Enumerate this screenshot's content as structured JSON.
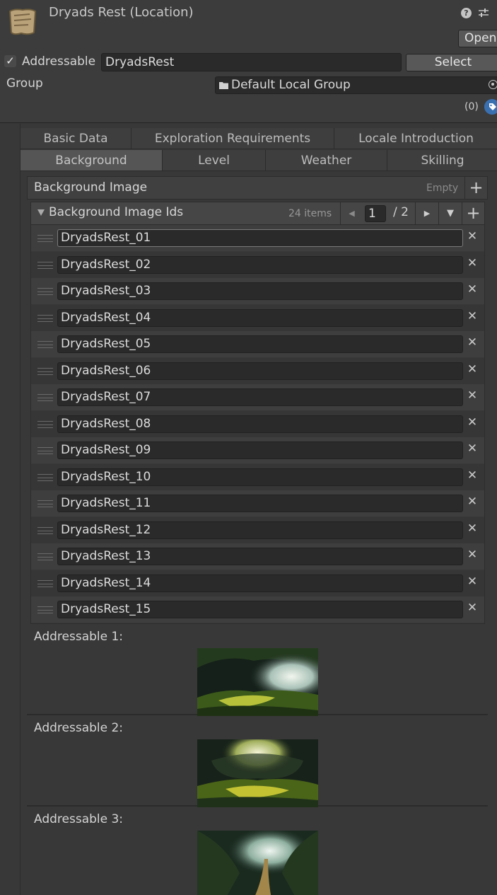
{
  "header": {
    "title": "Dryads Rest (Location)",
    "help_glyph": "?",
    "open_label": "Open"
  },
  "addressable": {
    "checked": true,
    "check_glyph": "✓",
    "label": "Addressable",
    "address": "DryadsRest",
    "select_label": "Select",
    "group_label": "Group",
    "group_value": "Default Local Group",
    "labels_count": "(0)"
  },
  "tabs": {
    "row1": [
      "Basic Data",
      "Exploration Requirements",
      "Locale Introduction"
    ],
    "row2": [
      "Background",
      "Level",
      "Weather",
      "Skilling"
    ],
    "active": "Background"
  },
  "background_image": {
    "label": "Background Image",
    "value": "Empty",
    "add_glyph": "+"
  },
  "background_ids": {
    "title": "Background Image Ids",
    "count": "24 items",
    "page": "1",
    "page_total": "/ 2",
    "prev_glyph": "◀",
    "next_glyph": "▶",
    "menu_glyph": "▼",
    "add_glyph": "+",
    "remove_glyph": "✕",
    "items": [
      "DryadsRest_01",
      "DryadsRest_02",
      "DryadsRest_03",
      "DryadsRest_04",
      "DryadsRest_05",
      "DryadsRest_06",
      "DryadsRest_07",
      "DryadsRest_08",
      "DryadsRest_09",
      "DryadsRest_10",
      "DryadsRest_11",
      "DryadsRest_12",
      "DryadsRest_13",
      "DryadsRest_14",
      "DryadsRest_15"
    ]
  },
  "previews": [
    {
      "label": "Addressable 1:"
    },
    {
      "label": "Addressable 2:"
    },
    {
      "label": "Addressable 3:"
    }
  ],
  "colors": {
    "editor_bg": "#383838",
    "field_bg": "#2a2a2a",
    "tag_blue": "#3a70b0",
    "forest_green": "#6f8a2a",
    "light_glow": "#e8efe0"
  }
}
